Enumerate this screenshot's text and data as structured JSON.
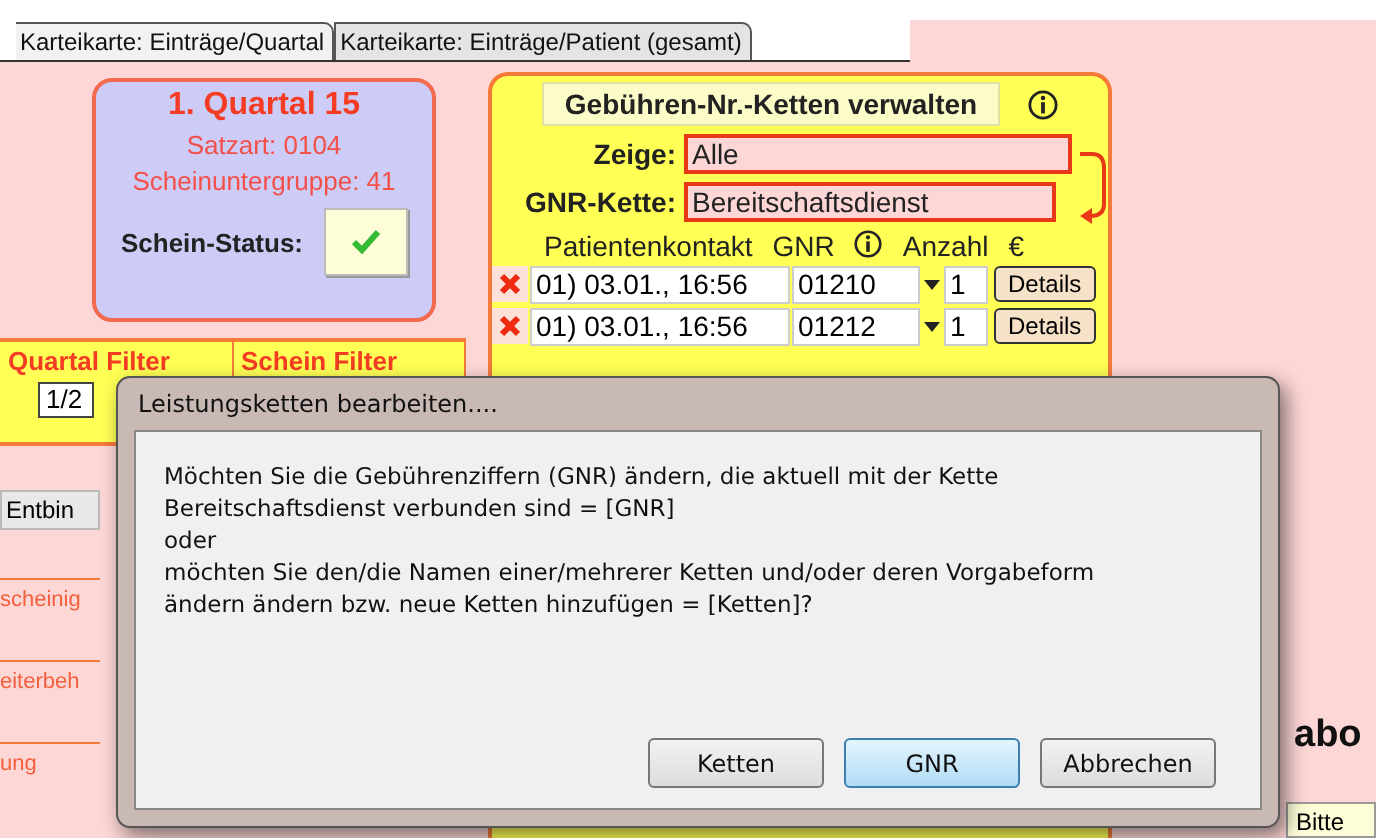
{
  "tabs": [
    {
      "label": "Karteikarte: Einträge/Quartal",
      "selected": true
    },
    {
      "label": "Karteikarte: Einträge/Patient (gesamt)",
      "selected": false
    }
  ],
  "quarter_card": {
    "title": "1. Quartal 15",
    "satzart": "Satzart: 0104",
    "scheinuntergruppe": "Scheinuntergruppe: 41",
    "status_label": "Schein-Status:",
    "status_ok": true
  },
  "chains_panel": {
    "button": "Gebühren-Nr.-Ketten verwalten",
    "show_label": "Zeige:",
    "show_value": "Alle",
    "chain_label": "GNR-Kette:",
    "chain_value": "Bereitschaftsdienst",
    "columns": [
      "Patientenkontakt",
      "GNR",
      "Anzahl",
      "€"
    ],
    "rows": [
      {
        "contact": "01) 03.01., 16:56",
        "gnr": "01210",
        "count": "1",
        "details": "Details"
      },
      {
        "contact": "01) 03.01., 16:56",
        "gnr": "01212",
        "count": "1",
        "details": "Details"
      }
    ]
  },
  "filter_tabs": [
    "Quartal Filter",
    "Schein Filter"
  ],
  "filter_value": "1/2",
  "left_stubs": [
    {
      "text": "Entbin",
      "kind": "button"
    },
    {
      "text": "scheinig",
      "kind": "label"
    },
    {
      "text": "eiterbeh",
      "kind": "label"
    },
    {
      "text": "ung",
      "kind": "label"
    }
  ],
  "right_stubs": {
    "heading": "abo",
    "note": "Bitte"
  },
  "dialog": {
    "title": "Leistungsketten bearbeiten....",
    "message_lines": [
      "Möchten Sie die Gebührenziffern (GNR) ändern, die aktuell mit der Kette",
      "Bereitschaftsdienst verbunden sind = [GNR]",
      "oder",
      "möchten Sie den/die Namen einer/mehrerer Ketten und/oder deren Vorgabeform",
      "ändern ändern bzw. neue Ketten hinzufügen = [Ketten]?"
    ],
    "buttons": [
      {
        "label": "Ketten",
        "default": false
      },
      {
        "label": "GNR",
        "default": true
      },
      {
        "label": "Abbrechen",
        "default": false
      }
    ]
  }
}
